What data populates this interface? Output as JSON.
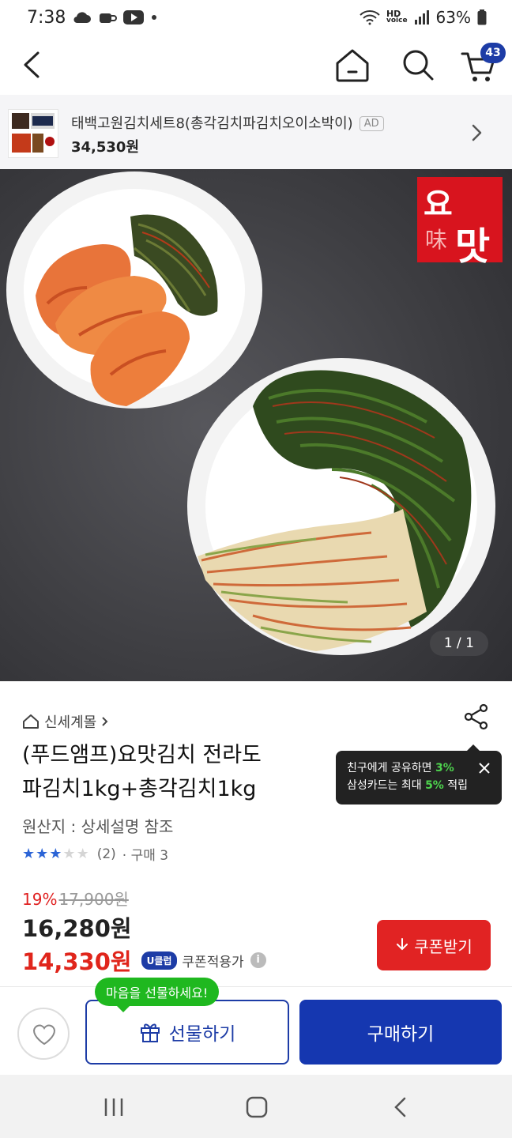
{
  "status_bar": {
    "time": "7:38",
    "hd_label": "HD",
    "voice_label": "voice",
    "battery": "63%",
    "left_icons": [
      "cloud-icon",
      "coffee-icon",
      "youtube-icon",
      "dot-icon"
    ],
    "right_icons": [
      "wifi-icon",
      "signal-icon",
      "battery-icon"
    ]
  },
  "header": {
    "back_icon": "chevron-left-icon",
    "home_icon": "home-icon",
    "search_icon": "search-icon",
    "cart_icon": "cart-icon",
    "cart_count": "43"
  },
  "ad": {
    "title": "태백고원김치세트8(총각김치파김치오이소박이)",
    "badge": "AD",
    "price": "34,530원"
  },
  "hero": {
    "logo_top": "요",
    "logo_hanja": "味",
    "logo_main": "맛",
    "pager": "1 / 1"
  },
  "product": {
    "store_name": "신세계몰",
    "title_line1": "(푸드앰프)요맛김치 전라도",
    "title_line2": "파김치1kg+총각김치1kg",
    "origin": "원산지 : 상세설명 참조",
    "rating_stars": 3,
    "rating_max": 5,
    "review_count": "(2)",
    "purchase_count": "· 구매 3",
    "discount_rate": "19%",
    "original_price": "17,900원",
    "price": "16,280원",
    "coupon_price": "14,330원",
    "uclub_badge": "U클럽",
    "coupon_note": "쿠폰적용가",
    "info_icon": "i",
    "coupon_button": "쿠폰받기"
  },
  "share_tooltip": {
    "line1_a": "친구에게 공유하면 ",
    "line1_pct": "3%",
    "line2_a": "삼성카드는 최대 ",
    "line2_pct": "5%",
    "line2_b": " 적립",
    "close_icon": "close-icon"
  },
  "colors": {
    "accent_blue": "#1537b0",
    "sale_red": "#e0251b",
    "promo_green": "#1fb81f",
    "star_blue": "#2b64d6"
  },
  "actions": {
    "gift_bubble": "마음을 선물하세요!",
    "gift_button": "선물하기",
    "buy_button": "구매하기"
  }
}
